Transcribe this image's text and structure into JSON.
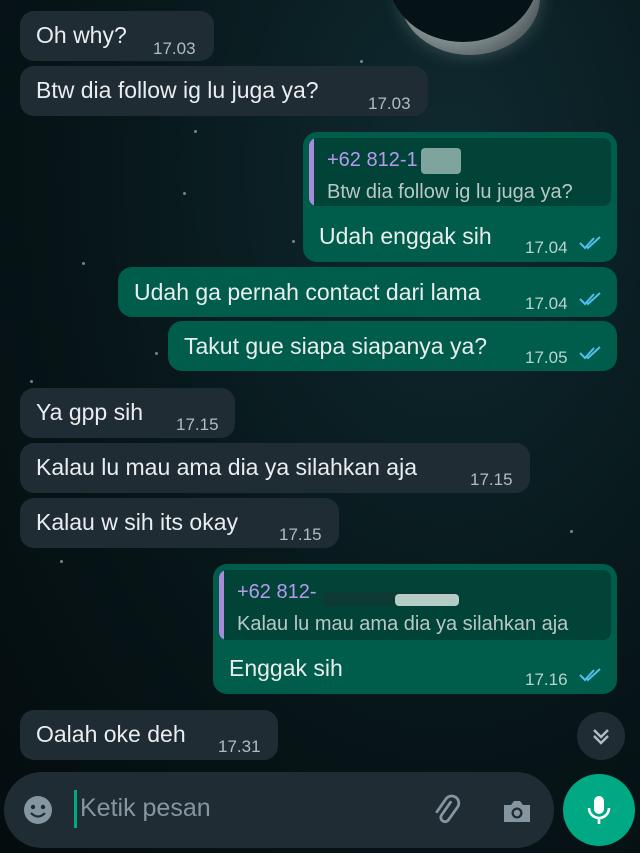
{
  "messages": [
    {
      "id": "m1",
      "direction": "in",
      "text": "Oh why?",
      "time": "17.03"
    },
    {
      "id": "m2",
      "direction": "in",
      "text": "Btw dia follow ig lu juga ya?",
      "time": "17.03"
    },
    {
      "id": "m3",
      "direction": "out",
      "quote": {
        "name": "+62 812-1",
        "text": "Btw dia follow ig lu juga ya?"
      },
      "text": "Udah enggak sih",
      "time": "17.04",
      "status": "read"
    },
    {
      "id": "m4",
      "direction": "out",
      "text": "Udah ga pernah contact dari lama",
      "time": "17.04",
      "status": "read"
    },
    {
      "id": "m5",
      "direction": "out",
      "text": "Takut gue siapa siapanya ya?",
      "time": "17.05",
      "status": "read"
    },
    {
      "id": "m6",
      "direction": "in",
      "text": "Ya gpp sih",
      "time": "17.15"
    },
    {
      "id": "m7",
      "direction": "in",
      "text": "Kalau lu mau ama dia ya silahkan aja",
      "time": "17.15"
    },
    {
      "id": "m8",
      "direction": "in",
      "text": "Kalau w sih its okay",
      "time": "17.15"
    },
    {
      "id": "m9",
      "direction": "out",
      "quote": {
        "name": "+62 812-",
        "text": "Kalau lu mau ama dia ya silahkan aja"
      },
      "text": "Enggak sih",
      "time": "17.16",
      "status": "read"
    },
    {
      "id": "m10",
      "direction": "in",
      "text": "Oalah oke deh",
      "time": "17.31"
    }
  ],
  "composer": {
    "placeholder": "Ketik pesan",
    "icons": [
      "emoji-icon",
      "attach-icon",
      "camera-icon",
      "mic-icon"
    ]
  },
  "scroll_button": {
    "icon": "double-chevron-down-icon"
  },
  "colors": {
    "incoming_bubble": "#1f2c34",
    "outgoing_bubble": "#005c4b",
    "accent": "#00a884",
    "read_ticks": "#53bdeb",
    "quote_bar": "#a58bd8"
  }
}
